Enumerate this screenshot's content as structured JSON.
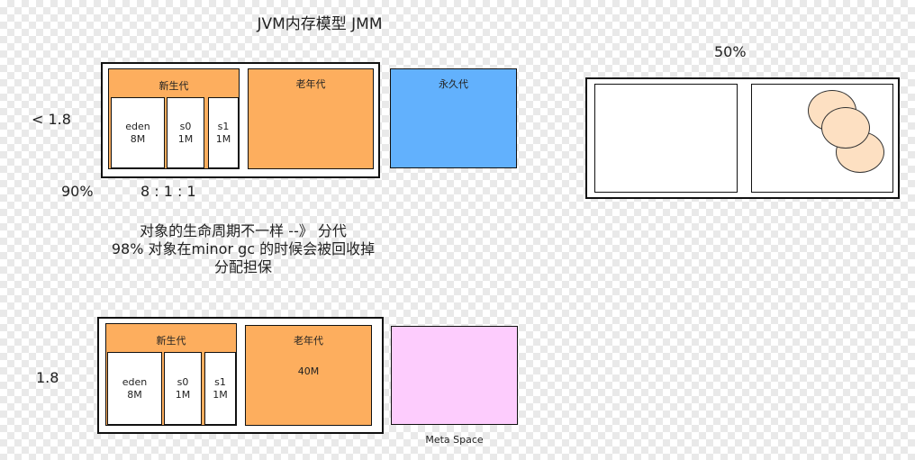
{
  "title": "JVM内存模型 JMM",
  "top_diagram": {
    "side_label": "< 1.8",
    "young_label": "新生代",
    "eden": {
      "name": "eden",
      "size": "8M"
    },
    "s0": {
      "name": "s0",
      "size": "1M"
    },
    "s1": {
      "name": "s1",
      "size": "1M"
    },
    "old_label": "老年代",
    "perm_label": "永久代",
    "percent_label": "90%",
    "ratio_label": "8 : 1 : 1"
  },
  "notes": [
    "对象的生命周期不一样 --》 分代",
    "98% 对象在minor gc 的时候会被回收掉",
    "分配担保"
  ],
  "bottom_diagram": {
    "side_label": "1.8",
    "young_label": "新生代",
    "eden": {
      "name": "eden",
      "size": "8M"
    },
    "s0": {
      "name": "s0",
      "size": "1M"
    },
    "s1": {
      "name": "s1",
      "size": "1M"
    },
    "old_label": "老年代",
    "old_size": "40M",
    "meta_label": "Meta Space"
  },
  "right_diagram": {
    "percent_label": "50%"
  },
  "colors": {
    "young": "#fdae5e",
    "old": "#fdae5e",
    "perm": "#62b1fd",
    "meta": "#fdccfd",
    "object": "#fde0c2"
  }
}
